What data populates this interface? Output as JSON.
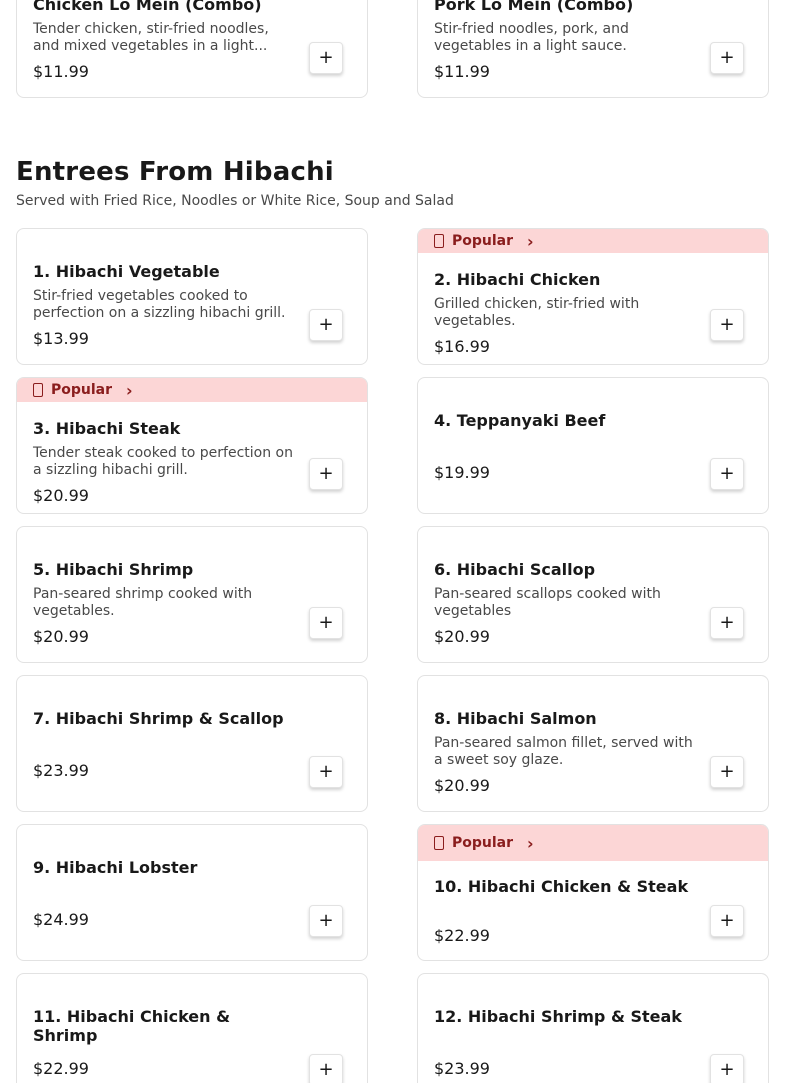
{
  "top_items": [
    {
      "name": "Chicken Lo Mein (Combo)",
      "desc": "Tender chicken, stir-fried noodles, and mixed vegetables in a light...",
      "price": "$11.99",
      "add": "+"
    },
    {
      "name": "Pork Lo Mein (Combo)",
      "desc": "Stir-fried noodles, pork, and vegetables in a light sauce.",
      "price": "$11.99",
      "add": "+"
    }
  ],
  "section": {
    "title": "Entrees From Hibachi",
    "subtitle": "Served with Fried Rice, Noodles or White Rice, Soup and Salad"
  },
  "popular_label": "Popular",
  "items": [
    {
      "name": "1. Hibachi Vegetable",
      "desc": "Stir-fried vegetables cooked to perfection on a sizzling hibachi grill.",
      "price": "$13.99",
      "popular": false,
      "add": "+"
    },
    {
      "name": "2. Hibachi Chicken",
      "desc": "Grilled chicken, stir-fried with vegetables.",
      "price": "$16.99",
      "popular": true,
      "add": "+"
    },
    {
      "name": "3. Hibachi Steak",
      "desc": "Tender steak cooked to perfection on a sizzling hibachi grill.",
      "price": "$20.99",
      "popular": true,
      "add": "+"
    },
    {
      "name": "4. Teppanyaki Beef",
      "desc": "",
      "price": "$19.99",
      "popular": false,
      "add": "+"
    },
    {
      "name": "5. Hibachi Shrimp",
      "desc": "Pan-seared shrimp cooked with vegetables.",
      "price": "$20.99",
      "popular": false,
      "add": "+"
    },
    {
      "name": "6. Hibachi Scallop",
      "desc": "Pan-seared scallops cooked with vegetables",
      "price": "$20.99",
      "popular": false,
      "add": "+"
    },
    {
      "name": "7. Hibachi Shrimp & Scallop",
      "desc": "",
      "price": "$23.99",
      "popular": false,
      "add": "+"
    },
    {
      "name": "8. Hibachi Salmon",
      "desc": "Pan-seared salmon fillet, served with a sweet soy glaze.",
      "price": "$20.99",
      "popular": false,
      "add": "+"
    },
    {
      "name": "9. Hibachi Lobster",
      "desc": "",
      "price": "$24.99",
      "popular": false,
      "add": "+"
    },
    {
      "name": "10. Hibachi Chicken & Steak",
      "desc": "",
      "price": "$22.99",
      "popular": true,
      "add": "+"
    },
    {
      "name": "11. Hibachi Chicken & Shrimp",
      "desc": "",
      "price": "$22.99",
      "popular": false,
      "add": "+"
    },
    {
      "name": "12. Hibachi Shrimp & Steak",
      "desc": "",
      "price": "$23.99",
      "popular": false,
      "add": "+"
    }
  ],
  "icons": {
    "popular": "flame-icon",
    "chevron": "chevron-right-icon",
    "add": "plus-icon"
  },
  "colors": {
    "popular_bg": "#fcd6d6",
    "popular_text": "#8a1d1d",
    "text": "#191919",
    "muted": "#494949",
    "border": "#e2e2e2"
  }
}
